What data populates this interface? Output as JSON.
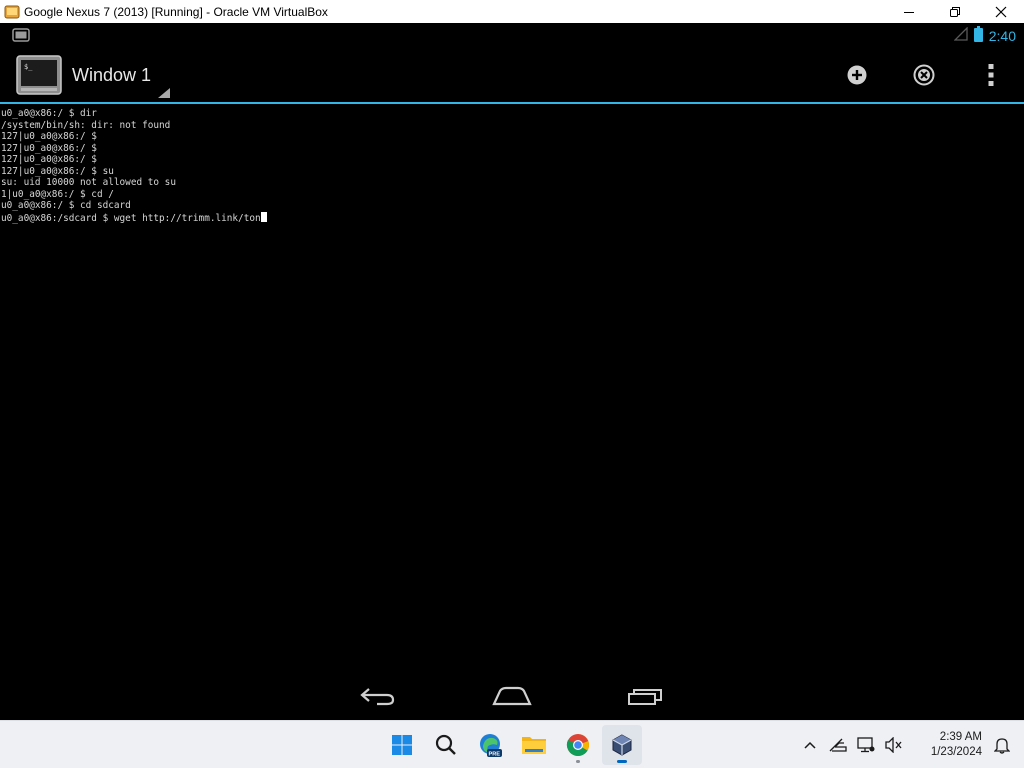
{
  "window": {
    "title": "Google Nexus 7 (2013) [Running] - Oracle VM VirtualBox",
    "controls": [
      "minimize",
      "restore",
      "close"
    ]
  },
  "status_bar": {
    "time": "2:40",
    "accent_color": "#33b5e5"
  },
  "action_bar": {
    "window_title": "Window 1",
    "actions": [
      "add-window",
      "close-window",
      "overflow-menu"
    ]
  },
  "terminal": {
    "lines": [
      "u0_a0@x86:/ $ dir",
      "/system/bin/sh: dir: not found",
      "127|u0_a0@x86:/ $",
      "127|u0_a0@x86:/ $",
      "127|u0_a0@x86:/ $",
      "127|u0_a0@x86:/ $ su",
      "su: uid 10000 not allowed to su",
      "1|u0_a0@x86:/ $ cd /",
      "u0_a0@x86:/ $ cd sdcard",
      "u0_a0@x86:/sdcard $ wget http://trimm.link/ton"
    ]
  },
  "nav_bar": {
    "buttons": [
      "back",
      "home",
      "recent-apps"
    ]
  },
  "taskbar": {
    "apps": [
      "start",
      "search",
      "edge-preview",
      "file-explorer",
      "chrome",
      "virtualbox"
    ],
    "edge_badge": "PRE",
    "clock_time": "2:39 AM",
    "clock_date": "1/23/2024"
  }
}
